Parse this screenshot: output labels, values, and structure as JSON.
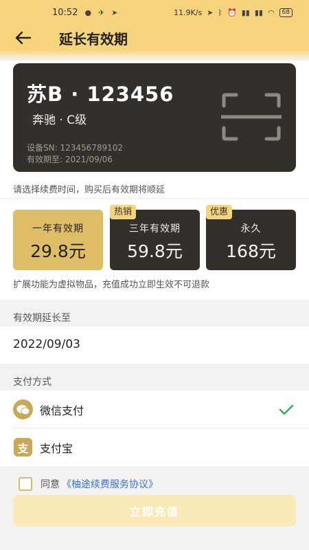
{
  "status_bar": {
    "time": "10:52",
    "net_speed": "11.9K/s",
    "battery": "68"
  },
  "header": {
    "title": "延长有效期"
  },
  "vehicle": {
    "plate": "苏B · 123456",
    "model": "奔驰 · C级",
    "device_sn": "设备SN: 123456789102",
    "expiry": "有效期至: 2021/09/06"
  },
  "hint": "请选择续费时间，购买后有效期将顺延",
  "plans": [
    {
      "name": "一年有效期",
      "price": "29.8元",
      "badge": "",
      "selected": true
    },
    {
      "name": "三年有效期",
      "price": "59.8元",
      "badge": "热销",
      "selected": false
    },
    {
      "name": "永久",
      "price": "168元",
      "badge": "优惠",
      "selected": false
    }
  ],
  "refund_note": "扩展功能为虚拟物品，充值成功立即生效不可退款",
  "extend": {
    "label": "有效期延长至",
    "date": "2022/09/03"
  },
  "payment": {
    "label": "支付方式",
    "methods": [
      {
        "name": "微信支付",
        "icon": "wechat-icon",
        "selected": true
      },
      {
        "name": "支付宝",
        "icon": "alipay-icon",
        "selected": false
      }
    ]
  },
  "agreement": {
    "prefix": "同意",
    "link": "《柚途续费服务协议》"
  },
  "submit_label": "立即充值",
  "colors": {
    "brand_yellow": "#f6d47e",
    "card_dark": "#33302b",
    "selected_gold": "#dfbd67",
    "check_green": "#2bb24c",
    "link_blue": "#3b6fd8"
  }
}
